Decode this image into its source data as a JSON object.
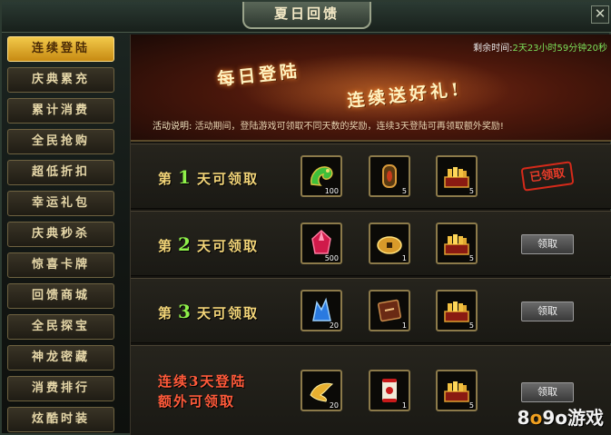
{
  "window": {
    "title": "夏日回馈",
    "close_symbol": "✕"
  },
  "sidebar": {
    "items": [
      {
        "label": "连续登陆",
        "active": true
      },
      {
        "label": "庆典累充"
      },
      {
        "label": "累计消费"
      },
      {
        "label": "全民抢购"
      },
      {
        "label": "超低折扣"
      },
      {
        "label": "幸运礼包"
      },
      {
        "label": "庆典秒杀"
      },
      {
        "label": "惊喜卡牌"
      },
      {
        "label": "回馈商城"
      },
      {
        "label": "全民探宝"
      },
      {
        "label": "神龙密藏"
      },
      {
        "label": "消费排行"
      },
      {
        "label": "炫酷时装"
      }
    ]
  },
  "banner": {
    "title_part1": "每日登陆",
    "title_part2": "连续送好礼!",
    "timer_label": "剩余时间:",
    "timer_value": "2天23小时59分钟20秒",
    "desc_label": "活动说明:",
    "desc_text": "活动期间，登陆游戏可领取不同天数的奖励，连续3天登陆可再领取额外奖励!"
  },
  "rows": [
    {
      "prefix": "第",
      "day": "1",
      "suffix": "天可领取",
      "items": [
        {
          "icon": "green-dragon-icon",
          "count": "100"
        },
        {
          "icon": "bronze-amulet-icon",
          "count": "5"
        },
        {
          "icon": "gold-treasure-chest-icon",
          "count": "5"
        }
      ],
      "action": {
        "type": "claimed",
        "label": "已领取"
      }
    },
    {
      "prefix": "第",
      "day": "2",
      "suffix": "天可领取",
      "items": [
        {
          "icon": "red-crystal-icon",
          "count": "500"
        },
        {
          "icon": "gold-coin-icon",
          "count": "1"
        },
        {
          "icon": "gold-treasure-chest-icon",
          "count": "5"
        }
      ],
      "action": {
        "type": "button",
        "label": "领取"
      }
    },
    {
      "prefix": "第",
      "day": "3",
      "suffix": "天可领取",
      "items": [
        {
          "icon": "blue-crystal-icon",
          "count": "20"
        },
        {
          "icon": "brown-scroll-book-icon",
          "count": "1"
        },
        {
          "icon": "gold-treasure-chest-icon",
          "count": "5"
        }
      ],
      "action": {
        "type": "button",
        "label": "领取"
      }
    }
  ],
  "bonus_row": {
    "line1": "连续3天登陆",
    "line2": "额外可领取",
    "items": [
      {
        "icon": "golden-wing-icon",
        "count": "20"
      },
      {
        "icon": "red-scroll-icon",
        "count": "1"
      },
      {
        "icon": "gold-treasure-chest-icon",
        "count": "5"
      }
    ],
    "action": {
      "type": "button",
      "label": "领取"
    }
  },
  "watermark": {
    "prefix": "8",
    "accent": "o",
    "suffix": "9o游戏"
  },
  "colors": {
    "accent": "#f2c94a",
    "day_number": "#8ff04a",
    "timer": "#7be05a",
    "claimed_stamp": "#e63a28"
  }
}
